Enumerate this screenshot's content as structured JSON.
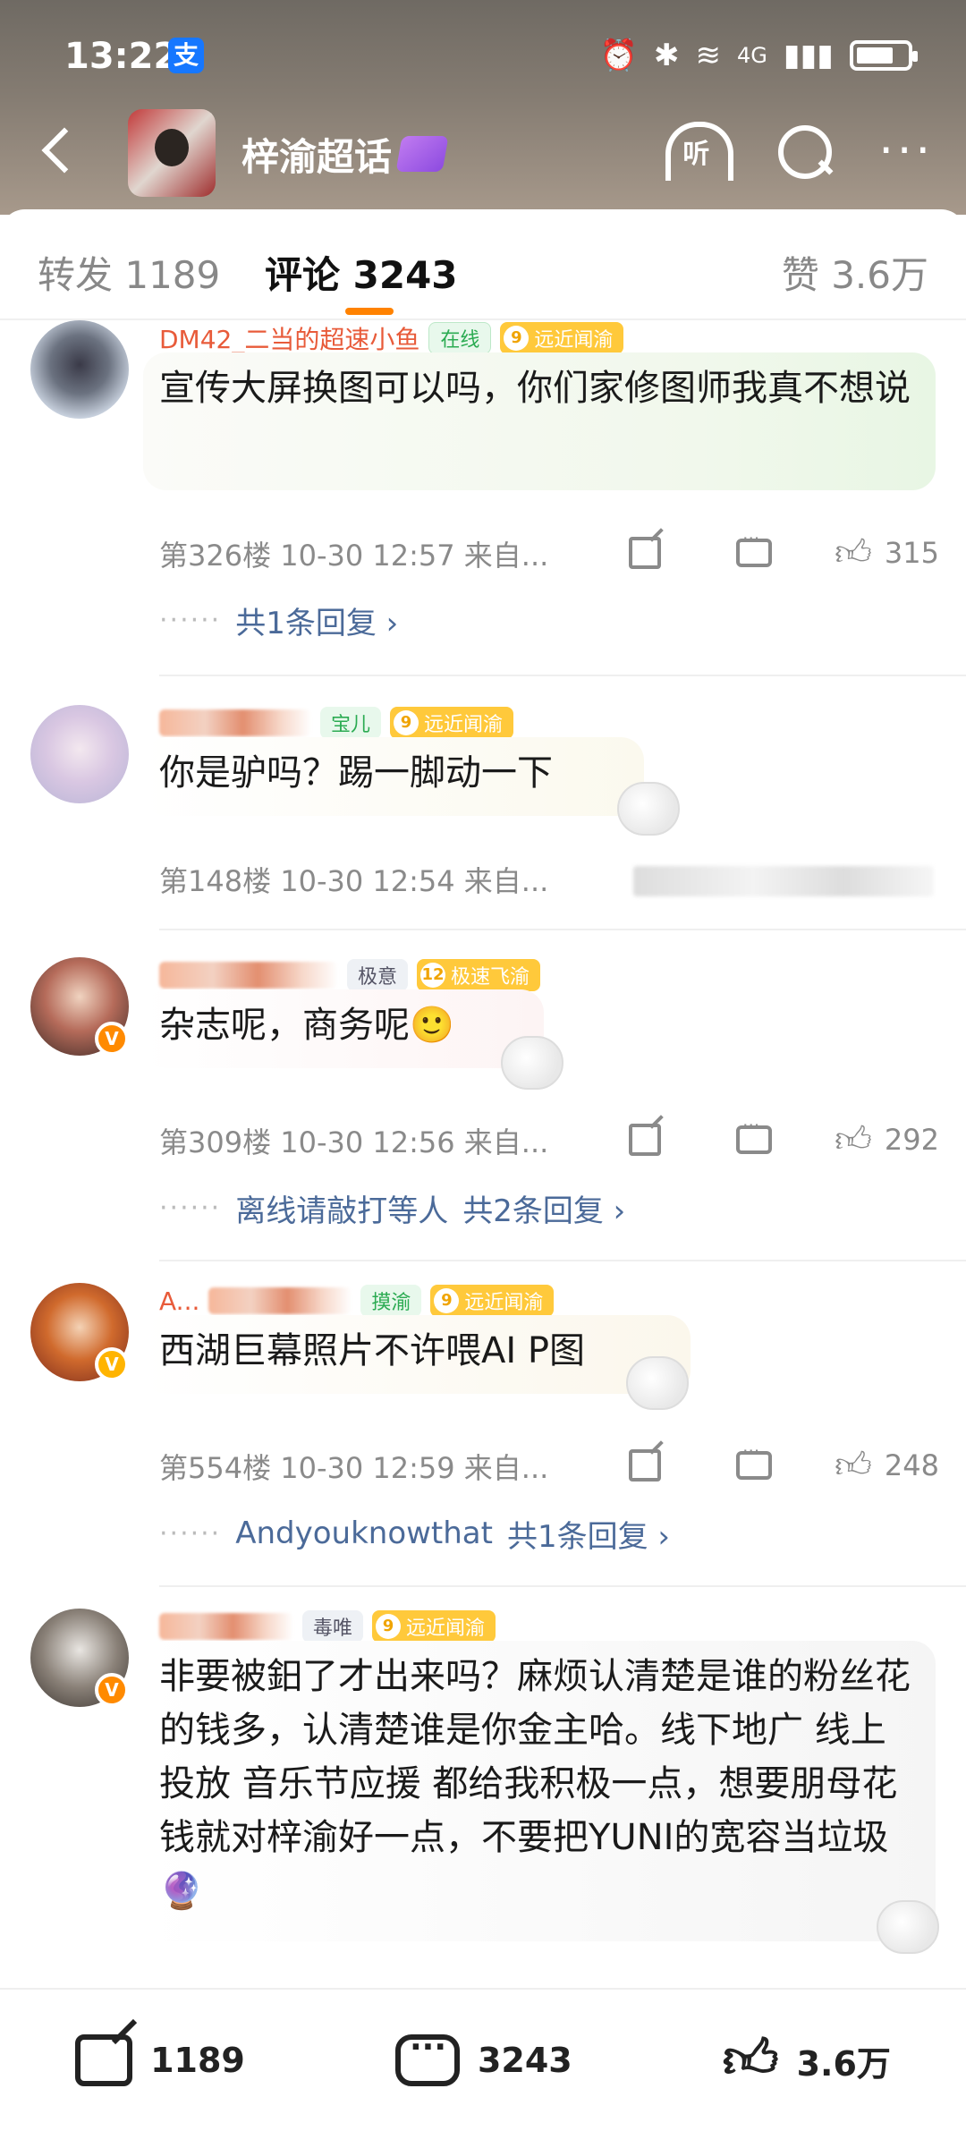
{
  "status": {
    "time": "13:22",
    "alipay": "支",
    "net": "4G"
  },
  "header": {
    "title": "梓渝超话"
  },
  "tabs": {
    "repost": "转发 1189",
    "comment": "评论 3243",
    "like": "赞 3.6万"
  },
  "comments": [
    {
      "name": "DM42_二当的超速小鱼",
      "tags": [
        "在线",
        "远近闻渝"
      ],
      "level": "9",
      "text": "宣传大屏换图可以吗，你们家修图师我真不想说",
      "floor": "第326楼 10-30 12:57 来自...",
      "likes": "315",
      "reply": {
        "user": "",
        "count": "共1条回复 ›"
      }
    },
    {
      "name": "",
      "tags": [
        "宝儿",
        "远近闻渝"
      ],
      "level": "9",
      "text": "你是驴吗？踢一脚动一下",
      "floor": "第148楼 10-30 12:54 来自...",
      "likes": ""
    },
    {
      "name": "",
      "tags": [
        "极意",
        "极速飞渝"
      ],
      "level": "12",
      "text": "杂志呢，商务呢🙂",
      "floor": "第309楼 10-30 12:56 来自...",
      "likes": "292",
      "reply": {
        "user": "离线请敲打等人",
        "count": "共2条回复 ›"
      }
    },
    {
      "name": "A...",
      "tags": [
        "摸渝",
        "远近闻渝"
      ],
      "level": "9",
      "text": "西湖巨幕照片不许喂AI P图",
      "floor": "第554楼 10-30 12:59 来自...",
      "likes": "248",
      "reply": {
        "user": "Andyouknowthat",
        "count": "共1条回复 ›"
      }
    },
    {
      "name": "",
      "tags": [
        "毒唯",
        "远近闻渝"
      ],
      "level": "9",
      "text": "非要被鈤了才出来吗？麻烦认清楚是谁的粉丝花的钱多，认清楚谁是你金主哈。线下地广 线上投放 音乐节应援 都给我积极一点，想要朋母花钱就对梓渝好一点，不要把YUNI的宽容当垃圾 🔮"
    }
  ],
  "bottom": {
    "repost": "1189",
    "comment": "3243",
    "like": "3.6万"
  },
  "icons": {
    "back": "back-icon",
    "listen": "listen-icon",
    "search": "search-icon",
    "more": "more-icon",
    "share": "share-icon",
    "comment": "comment-icon",
    "like": "like-icon"
  },
  "colors": {
    "accent": "#ff8200",
    "reply_link": "#4b6a99",
    "level_tag": "#ffc93b"
  }
}
